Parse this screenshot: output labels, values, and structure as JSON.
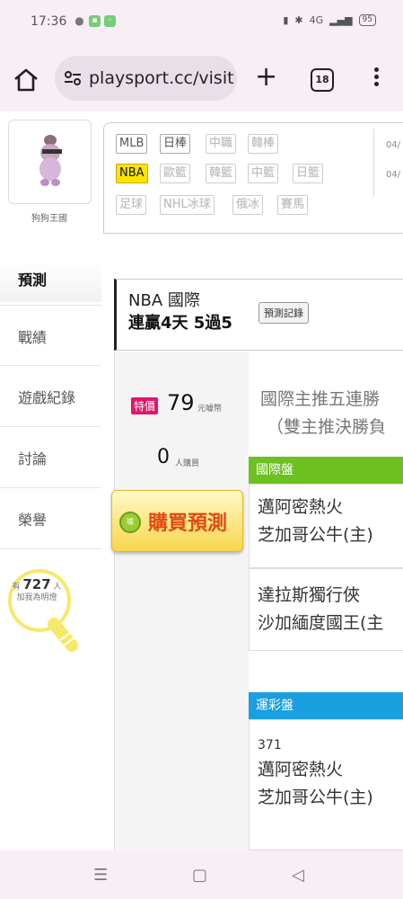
{
  "status_bar": {
    "time": "17:36",
    "network": "4G",
    "battery": "95"
  },
  "browser": {
    "url": "playsport.cc/visit",
    "tab_count": "18"
  },
  "profile": {
    "name": "狗狗王國"
  },
  "sidebar": {
    "items": [
      {
        "label": "預測"
      },
      {
        "label": "戰績"
      },
      {
        "label": "遊戲紀錄"
      },
      {
        "label": "討論"
      },
      {
        "label": "榮譽"
      }
    ],
    "bulb": {
      "prefix": "有",
      "count": "727",
      "suffix": "人",
      "note": "加我為明燈"
    }
  },
  "game_tags": {
    "row1": [
      "MLB",
      "日棒",
      "中職",
      "韓棒"
    ],
    "row2": [
      "NBA",
      "歐籃",
      "韓籃",
      "中籃",
      "日籃"
    ],
    "row3": [
      "足球",
      "NHL冰球",
      "俄冰",
      "賽馬"
    ],
    "dates": [
      "04/",
      "04/"
    ]
  },
  "title": {
    "league": "NBA 國際",
    "streak": "連贏4天 5過5",
    "record_button": "預測記錄"
  },
  "purchase": {
    "sale_badge": "特價",
    "price": "79",
    "price_unit": "元噱幣",
    "buyers": "0",
    "buyers_unit": "人購買",
    "buy_button": "購買預測"
  },
  "pick": {
    "line1": "國際主推五連勝",
    "line2": "（雙主推決勝負"
  },
  "intl_market": {
    "header": "國際盤",
    "games": [
      {
        "team1": "邁阿密熱火",
        "team2": "芝加哥公牛(主)"
      },
      {
        "team1": "達拉斯獨行俠",
        "team2": "沙加緬度國王(主"
      }
    ]
  },
  "lottery_market": {
    "header": "運彩盤",
    "games": [
      {
        "code": "371",
        "team1": "邁阿密熱火",
        "team2": "芝加哥公牛(主)"
      }
    ]
  },
  "nav": {
    "menu": "☰",
    "home": "▢",
    "back": "◁"
  }
}
